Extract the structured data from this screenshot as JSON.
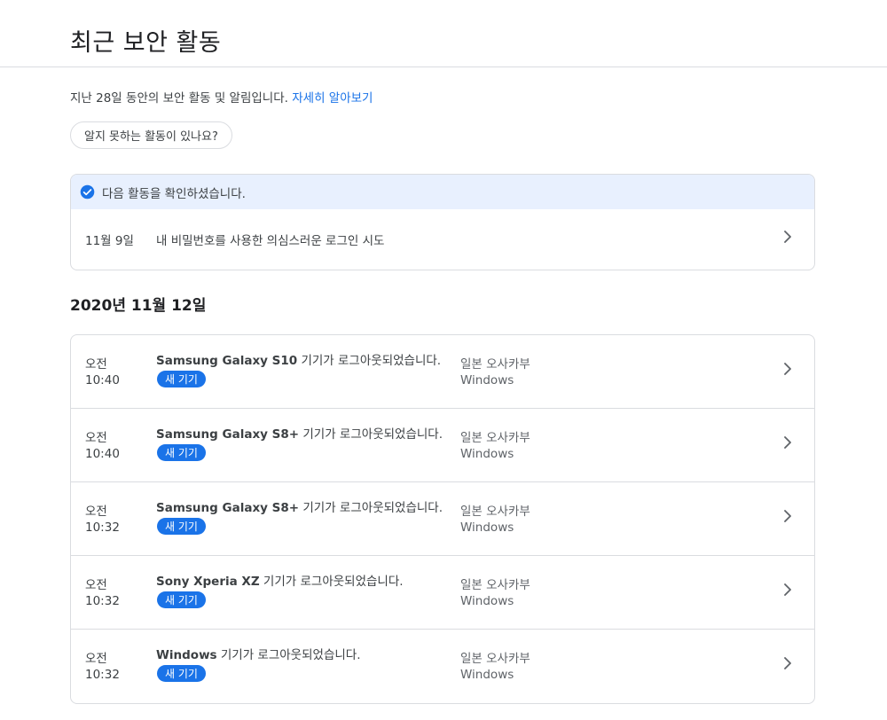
{
  "page": {
    "title": "최근 보안 활동"
  },
  "intro": {
    "text": "지난 28일 동안의 보안 활동 및 알림입니다. ",
    "link": "자세히 알아보기"
  },
  "unknown_activity_button": "알지 못하는 활동이 있나요?",
  "reviewed": {
    "banner": "다음 활동을 확인하셨습니다.",
    "date": "11월 9일",
    "description": "내 비밀번호를 사용한 의심스러운 로그인 시도"
  },
  "section": {
    "date": "2020년 11월 12일"
  },
  "activities": [
    {
      "ampm": "오전",
      "time": "10:40",
      "device": "Samsung Galaxy S10",
      "message": " 기기가 로그아웃되었습니다.",
      "badge": "새 기기",
      "location": "일본 오사카부",
      "platform": "Windows"
    },
    {
      "ampm": "오전",
      "time": "10:40",
      "device": "Samsung Galaxy S8+",
      "message": " 기기가 로그아웃되었습니다.",
      "badge": "새 기기",
      "location": "일본 오사카부",
      "platform": "Windows"
    },
    {
      "ampm": "오전",
      "time": "10:32",
      "device": "Samsung Galaxy S8+",
      "message": " 기기가 로그아웃되었습니다.",
      "badge": "새 기기",
      "location": "일본 오사카부",
      "platform": "Windows"
    },
    {
      "ampm": "오전",
      "time": "10:32",
      "device": "Sony Xperia XZ",
      "message": " 기기가 로그아웃되었습니다.",
      "badge": "새 기기",
      "location": "일본 오사카부",
      "platform": "Windows"
    },
    {
      "ampm": "오전",
      "time": "10:32",
      "device": "Windows",
      "message": " 기기가 로그아웃되었습니다.",
      "badge": "새 기기",
      "location": "일본 오사카부",
      "platform": "Windows"
    }
  ],
  "icons": {
    "check": "check-circle-icon",
    "chevron": "chevron-right-icon"
  },
  "colors": {
    "accent": "#1a73e8",
    "banner_bg": "#e8f0fe",
    "border": "#dadce0"
  }
}
